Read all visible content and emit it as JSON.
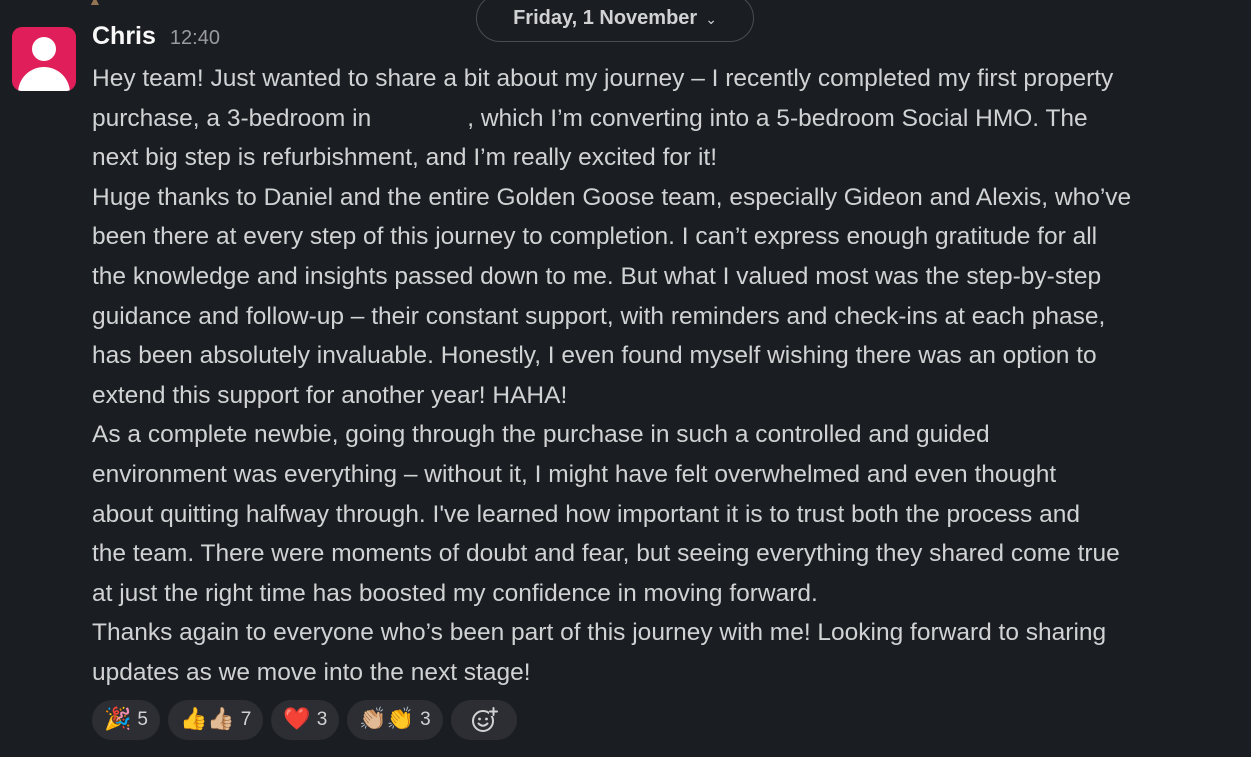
{
  "date_divider": {
    "label": "Friday, 1 November",
    "chevron": "chevron-down-icon"
  },
  "message": {
    "sender": "Chris",
    "time": "12:40",
    "avatar_color": "#e01e5a",
    "paragraphs": {
      "p1": {
        "line1": "Hey team! Just wanted to share a bit about my journey – I recently completed my first property",
        "line2a": "purchase, a 3-bedroom in",
        "line2b": ", which I’m converting into a 5-bedroom Social HMO. The",
        "line3": "next big step is refurbishment, and I’m really excited for it!"
      },
      "p2": {
        "line1": "Huge thanks to Daniel and the entire Golden Goose team, especially Gideon and Alexis, who’ve",
        "line2": "been there at every step of this journey to completion. I can’t express enough gratitude for all",
        "line3": "the knowledge and insights passed down to me. But what I valued most was the step-by-step",
        "line4": "guidance and follow-up – their constant support, with reminders and check-ins at each phase,",
        "line5": "has been absolutely invaluable. Honestly, I even found myself wishing there was an option to",
        "line6": "extend this support for another year! HAHA!"
      },
      "p3": {
        "line1": "As a complete newbie, going through the purchase in such a controlled and guided",
        "line2": "environment was everything – without it, I might have felt overwhelmed and even thought",
        "line3": "about quitting halfway through. I've learned how important it is to trust both the process and",
        "line4": "the team. There were moments of doubt and fear, but seeing everything they shared come true",
        "line5": "at just the right time has boosted my confidence in moving forward."
      },
      "p4": {
        "line1": "Thanks again to everyone who’s been part of this journey with me! Looking forward to sharing",
        "line2": "updates as we move into the next stage!"
      }
    }
  },
  "reactions": [
    {
      "emoji": "🎉",
      "icon": "party-popper-icon",
      "count": "5"
    },
    {
      "emoji": "👍👍🏼",
      "icon": "thumbs-up-icon",
      "count": "7"
    },
    {
      "emoji": "❤️",
      "icon": "red-heart-icon",
      "count": "3"
    },
    {
      "emoji": "👏🏼👏",
      "icon": "clapping-hands-icon",
      "count": "3"
    }
  ],
  "add_reaction": {
    "icon": "add-reaction-icon"
  },
  "colors": {
    "background": "#1a1d21",
    "text": "#d1d2d3",
    "pill": "#2c2e33"
  }
}
